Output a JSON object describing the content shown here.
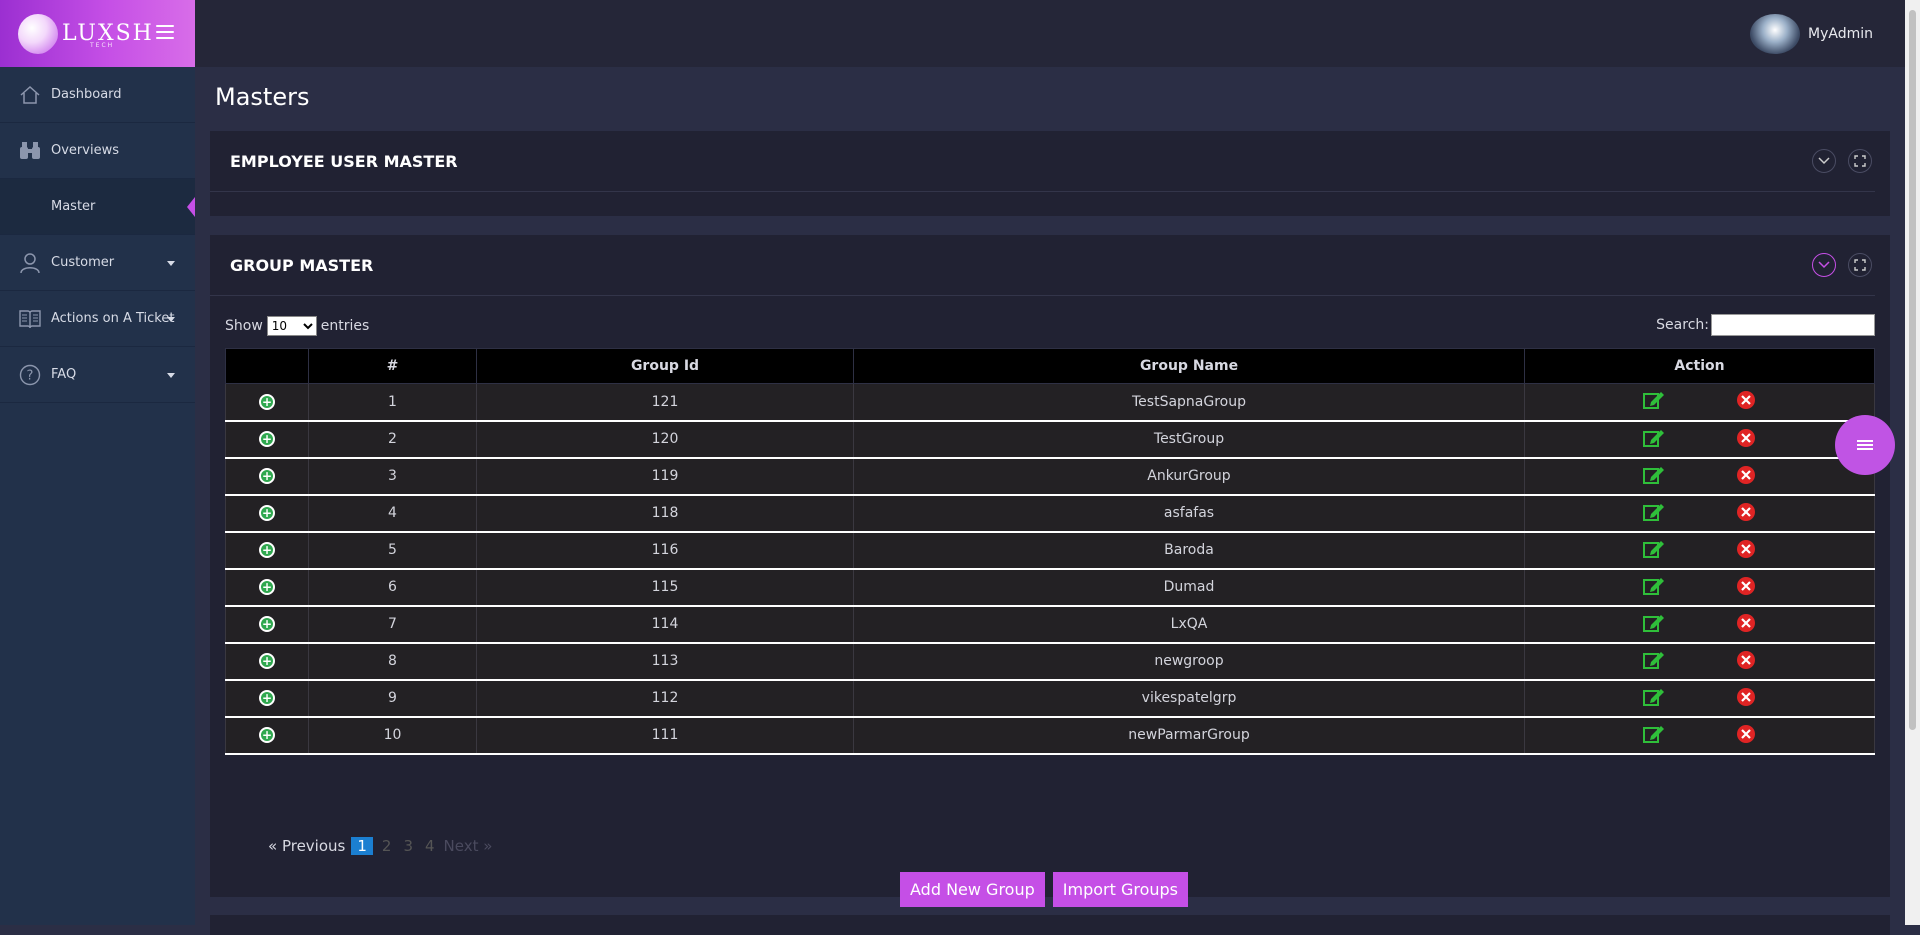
{
  "brand": {
    "logo_text": "LUXSH",
    "logo_sub": "TECH"
  },
  "sidebar": {
    "items": [
      {
        "label": "Dashboard",
        "icon": "home-icon"
      },
      {
        "label": "Overviews",
        "icon": "binoculars-icon"
      },
      {
        "label": "Master",
        "icon": ""
      },
      {
        "label": "Customer",
        "icon": "user-icon"
      },
      {
        "label": "Actions on A Ticket",
        "icon": "book-icon"
      },
      {
        "label": "FAQ",
        "icon": "question-icon"
      }
    ]
  },
  "header": {
    "user_name": "MyAdmin"
  },
  "page": {
    "title": "Masters"
  },
  "employee_panel": {
    "title": "EMPLOYEE USER MASTER"
  },
  "group_panel": {
    "title": "GROUP MASTER",
    "show_label": "Show",
    "entries_value": "10",
    "entries_label": "entries",
    "search_label": "Search:",
    "columns": [
      "",
      "#",
      "Group Id",
      "Group Name",
      "Action"
    ],
    "rows": [
      {
        "num": "1",
        "id": "121",
        "name": "TestSapnaGroup"
      },
      {
        "num": "2",
        "id": "120",
        "name": "TestGroup"
      },
      {
        "num": "3",
        "id": "119",
        "name": "AnkurGroup"
      },
      {
        "num": "4",
        "id": "118",
        "name": "asfafas"
      },
      {
        "num": "5",
        "id": "116",
        "name": "Baroda"
      },
      {
        "num": "6",
        "id": "115",
        "name": "Dumad"
      },
      {
        "num": "7",
        "id": "114",
        "name": "LxQA"
      },
      {
        "num": "8",
        "id": "113",
        "name": "newgroop"
      },
      {
        "num": "9",
        "id": "112",
        "name": "vikespatelgrp"
      },
      {
        "num": "10",
        "id": "111",
        "name": "newParmarGroup"
      }
    ],
    "pagination": {
      "prev": "« Previous",
      "pages": [
        "1",
        "2",
        "3",
        "4"
      ],
      "current": "1",
      "next": "Next »"
    },
    "buttons": {
      "add": "Add New Group",
      "import": "Import Groups"
    }
  },
  "colors": {
    "accent": "#c54fe6",
    "sidebar": "#22314a",
    "edit": "#2fbf3a",
    "delete": "#e02424"
  }
}
